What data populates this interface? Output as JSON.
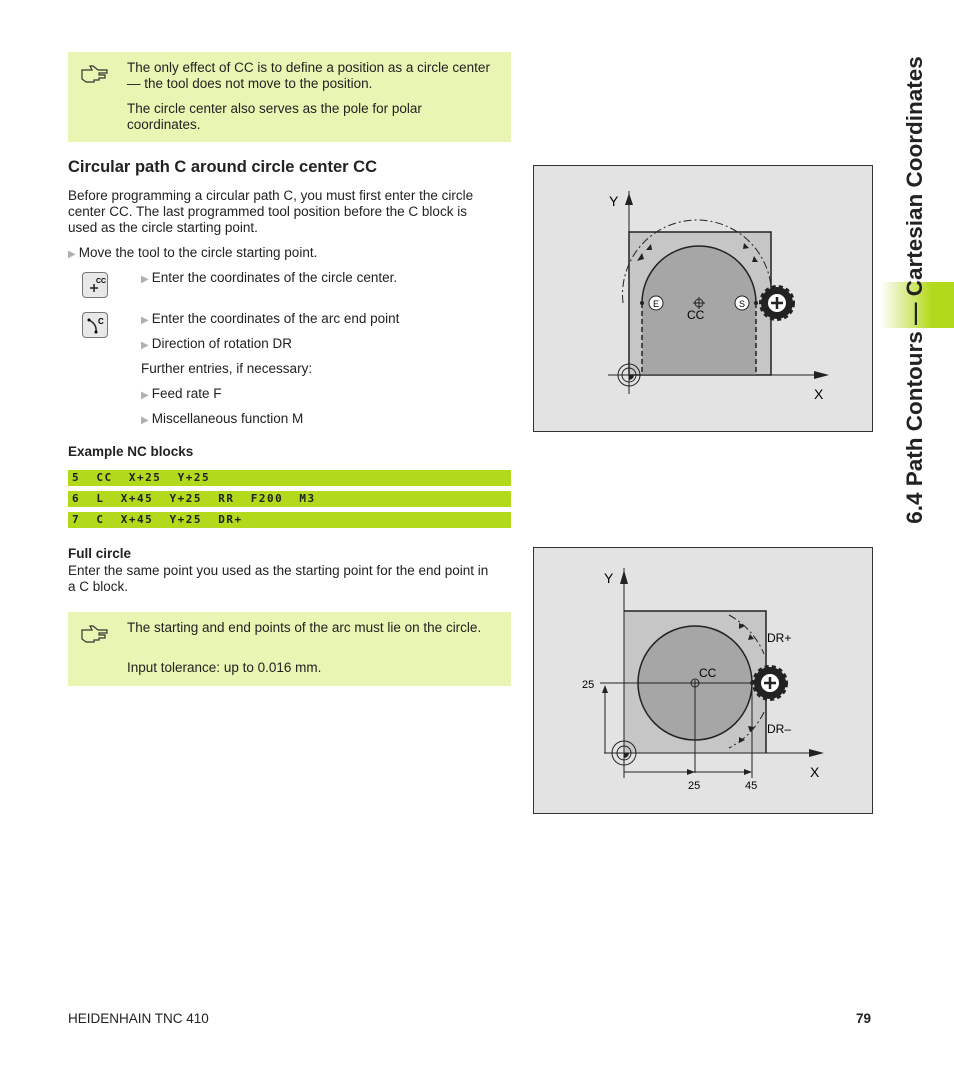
{
  "sidebar_title": "6.4 Path Contours — Cartesian Coordinates",
  "note1": {
    "icon": "pointing-hand-icon",
    "lines": [
      "The only effect of CC is to define a position as a circle center — the tool does not move to the position.",
      "The circle center also serves as the pole for polar coordinates."
    ]
  },
  "section_title": "Circular path C around circle center CC",
  "intro": "Before programming a circular path C, you must first enter the circle center CC. The last programmed tool position before the C block is used as the circle starting point.",
  "steps": {
    "move": "Move the tool to the circle starting point.",
    "cc_key": "Enter the coordinates of the circle center.",
    "c_key": "Enter the coordinates of the arc end point",
    "dr": "Direction of rotation DR",
    "further": "Further entries, if necessary:",
    "feed": "Feed rate F",
    "misc": "Miscellaneous function M"
  },
  "keys": {
    "cc_label": "CC",
    "c_label": "C"
  },
  "example_title": "Example NC blocks",
  "nc_blocks": [
    "5  CC  X+25  Y+25",
    "6  L  X+45  Y+25  RR  F200  M3",
    "7  C  X+45  Y+25  DR+"
  ],
  "full_circle": {
    "title": "Full circle",
    "text": "Enter the same point you used as the starting point for the end point in a C block."
  },
  "note2": {
    "icon": "pointing-hand-icon",
    "lines": [
      "The starting and end points of the arc must lie on the circle.",
      "Input tolerance: up to 0.016 mm."
    ]
  },
  "fig1": {
    "y": "Y",
    "x": "X",
    "e": "E",
    "s": "S",
    "cc": "CC"
  },
  "fig2": {
    "y": "Y",
    "x": "X",
    "cc": "CC",
    "drplus": "DR+",
    "drminus": "DR–",
    "y25": "25",
    "x25": "25",
    "x45": "45"
  },
  "footer": {
    "left": "HEIDENHAIN TNC 410",
    "page": "79"
  },
  "colors": {
    "note_bg": "#e9f5b3",
    "code_bg": "#b3d91c",
    "figure_bg": "#e3e3e3"
  }
}
